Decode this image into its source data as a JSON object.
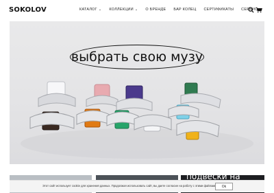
{
  "header": {
    "logo": "SOKOLOV",
    "nav": [
      {
        "label": "КАТАЛОГ",
        "has_dropdown": true
      },
      {
        "label": "КОЛЛЕКЦИИ",
        "has_dropdown": true
      },
      {
        "label": "О БРЕНДЕ",
        "has_dropdown": false
      },
      {
        "label": "БАР КОЛЕЦ",
        "has_dropdown": false
      },
      {
        "label": "СЕРТИФИКАТЫ",
        "has_dropdown": false
      },
      {
        "label": "СЕРВИС",
        "has_dropdown": true
      }
    ],
    "icons": [
      "search-icon",
      "cart-icon"
    ]
  },
  "hero": {
    "title": "выбрать свою музу"
  },
  "cards": [
    {
      "title": ""
    },
    {
      "title": ""
    },
    {
      "title": "подвески на"
    }
  ],
  "cookie": {
    "text": "Этот сайт использует cookie для хранения данных. Продолжая использовать сайт, вы даете согласие на работу с этими файлами.",
    "button": "Ok"
  },
  "colors": {
    "hero_bg": "#e6e6e8",
    "accent": "#111111"
  }
}
